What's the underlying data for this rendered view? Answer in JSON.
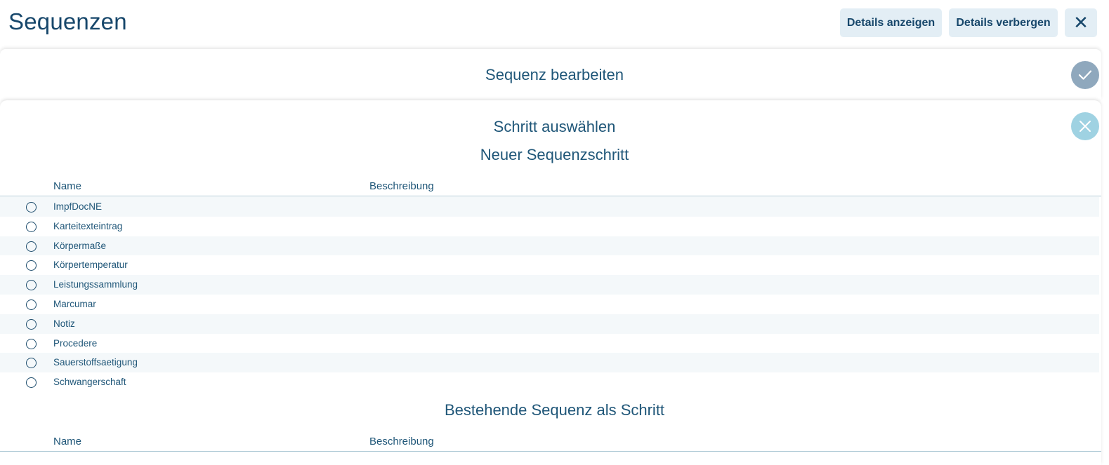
{
  "header": {
    "title": "Sequenzen",
    "show_details_label": "Details anzeigen",
    "hide_details_label": "Details verbergen",
    "close_label": "✕"
  },
  "edit_panel": {
    "title": "Sequenz bearbeiten",
    "confirm_icon": "checkmark-icon"
  },
  "step_panel": {
    "title": "Schritt auswählen",
    "cancel_icon": "close-icon",
    "new_step": {
      "title": "Neuer Sequenzschritt",
      "columns": [
        "Name",
        "Beschreibung"
      ],
      "rows": [
        {
          "name": "ImpfDocNE",
          "description": ""
        },
        {
          "name": "Karteitexteintrag",
          "description": ""
        },
        {
          "name": "Körpermaße",
          "description": ""
        },
        {
          "name": "Körpertemperatur",
          "description": ""
        },
        {
          "name": "Leistungssammlung",
          "description": ""
        },
        {
          "name": "Marcumar",
          "description": ""
        },
        {
          "name": "Notiz",
          "description": ""
        },
        {
          "name": "Procedere",
          "description": ""
        },
        {
          "name": "Sauerstoffsaetigung",
          "description": ""
        },
        {
          "name": "Schwangerschaft",
          "description": ""
        }
      ]
    },
    "existing": {
      "title": "Bestehende Sequenz als Schritt",
      "columns": [
        "Name",
        "Beschreibung"
      ]
    }
  },
  "colors": {
    "title": "#17476b",
    "button_bg": "#e3eef5",
    "confirm_circle": "#8fa8bd",
    "cancel_circle": "#9fd2e2",
    "row_alt": "#f4f8fa"
  }
}
